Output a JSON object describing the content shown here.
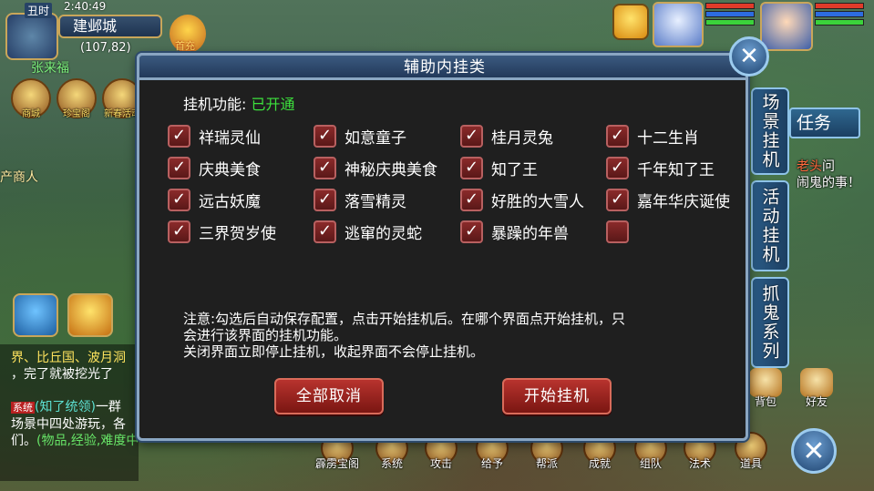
{
  "hud": {
    "shichen": "丑时",
    "clock": "2:40:49",
    "map_name": "建邺城",
    "coords": "(107,82)",
    "player_name": "张来福",
    "first_recharge": "首充",
    "npc_label": "产商人",
    "shop_icons": [
      {
        "label": "商城",
        "icon": "shop-icon"
      },
      {
        "label": "珍宝阁",
        "icon": "treasure-icon"
      },
      {
        "label": "新春活动",
        "icon": "festival-icon"
      }
    ]
  },
  "right_panel": {
    "tabs": [
      "场景挂机",
      "活动挂机",
      "抓鬼系列"
    ],
    "task_tab": "任务",
    "task_text_hl": "老头",
    "task_text_pre": "",
    "task_text_prefix_word": "……",
    "task_text_line1_rest": "问",
    "task_text_line2": "闹鬼的事！",
    "bottom_right": [
      {
        "label": "背包"
      },
      {
        "label": "好友"
      }
    ]
  },
  "bottom_bar": [
    {
      "label": "霹雳宝阁"
    },
    {
      "label": "系统"
    },
    {
      "label": "攻击"
    },
    {
      "label": "给予"
    },
    {
      "label": "帮派"
    },
    {
      "label": "成就"
    },
    {
      "label": "组队"
    },
    {
      "label": "法术"
    },
    {
      "label": "道具"
    }
  ],
  "chat": {
    "line1": "界、比丘国、波月洞",
    "line2": "，完了就被挖光了",
    "sys_tag": "系统",
    "line3_name": "(知了统领)",
    "line3_rest": "一群",
    "line4": "场景中四处游玩，各",
    "line5_pre": "们。",
    "line5_info": "(物品,经验,难度中)"
  },
  "dialog": {
    "title": "辅助内挂类",
    "status_label": "挂机功能: ",
    "status_value": "已开通",
    "options": [
      {
        "label": "祥瑞灵仙",
        "checked": true
      },
      {
        "label": "如意童子",
        "checked": true
      },
      {
        "label": "桂月灵兔",
        "checked": true
      },
      {
        "label": "十二生肖",
        "checked": true
      },
      {
        "label": "庆典美食",
        "checked": true
      },
      {
        "label": "神秘庆典美食",
        "checked": true
      },
      {
        "label": "知了王",
        "checked": true
      },
      {
        "label": "千年知了王",
        "checked": true
      },
      {
        "label": "远古妖魔",
        "checked": true
      },
      {
        "label": "落雪精灵",
        "checked": true
      },
      {
        "label": "好胜的大雪人",
        "checked": true
      },
      {
        "label": "嘉年华庆诞使",
        "checked": true
      },
      {
        "label": "三界贺岁使",
        "checked": true
      },
      {
        "label": "逃窜的灵蛇",
        "checked": true
      },
      {
        "label": "暴躁的年兽",
        "checked": true
      },
      {
        "label": "",
        "checked": false
      }
    ],
    "note_line1": "注意:勾选后自动保存配置，点击开始挂机后。在哪个界面点开始挂机，只",
    "note_line2": "会进行该界面的挂机功能。",
    "note_line3": "关闭界面立即停止挂机，收起界面不会停止挂机。",
    "cancel_all": "全部取消",
    "start": "开始挂机"
  },
  "colors": {
    "enabled_green": "#3ce03c",
    "checkbox_red": "#7a2020",
    "button_red": "#a0241f",
    "frame_blue": "#8aa6c2"
  }
}
